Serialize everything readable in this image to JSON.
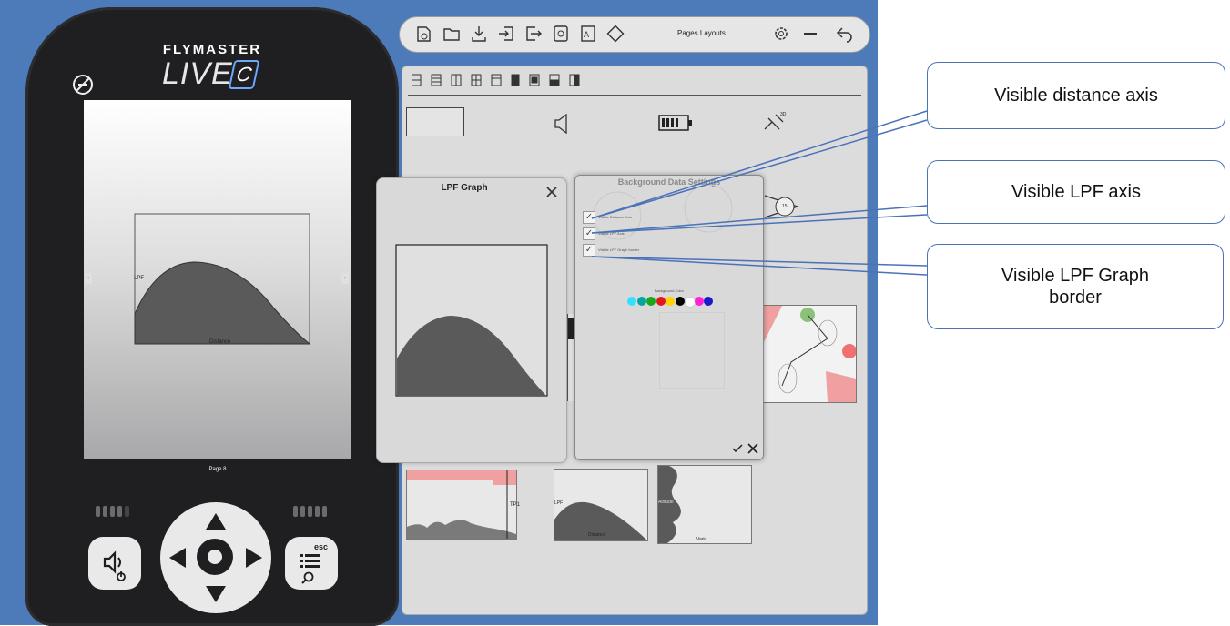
{
  "device": {
    "brand": "FLYMASTER",
    "logo_main": "LIVE",
    "logo_suffix": "C",
    "screen": {
      "graph_y_label": "LPF",
      "graph_x_label": "Distance",
      "page_label": "Page 8"
    },
    "buttons": {
      "esc_label": "esc"
    }
  },
  "toolbar": {
    "title": "Pages Layouts",
    "icons": [
      "new-page-icon",
      "open-folder-icon",
      "download-icon",
      "import-icon",
      "export-icon",
      "record-icon",
      "text-layout-icon",
      "rotate-icon",
      "settings-icon",
      "minimize-icon",
      "back-icon"
    ]
  },
  "panel": {
    "thumbnails": {
      "route_label": "TP1",
      "lpf_y_label": "LPF",
      "lpf_x_label": "Distance",
      "vario_label": "Vario",
      "altitude_label": "Altitude"
    },
    "compass_label": "15",
    "satellite_label": "3D"
  },
  "lpf_dialog": {
    "title": "LPF Graph"
  },
  "bg_dialog": {
    "title": "Background Data Settings",
    "options": [
      {
        "label": "Visible Distance Axis",
        "checked": true
      },
      {
        "label": "Visible LPF Axis",
        "checked": true
      },
      {
        "label": "Visible LPF Graph border",
        "checked": true
      }
    ],
    "color_label": "Background Color",
    "colors": [
      "#33e0ff",
      "#00a6a0",
      "#1aa81a",
      "#e01a1a",
      "#ffd400",
      "#000000",
      "#ffffff",
      "#ff22d6",
      "#1a1acc"
    ]
  },
  "callouts": {
    "distance_axis": "Visible distance axis",
    "lpf_axis": "Visible LPF axis",
    "lpf_border": "Visible LPF Graph border"
  }
}
